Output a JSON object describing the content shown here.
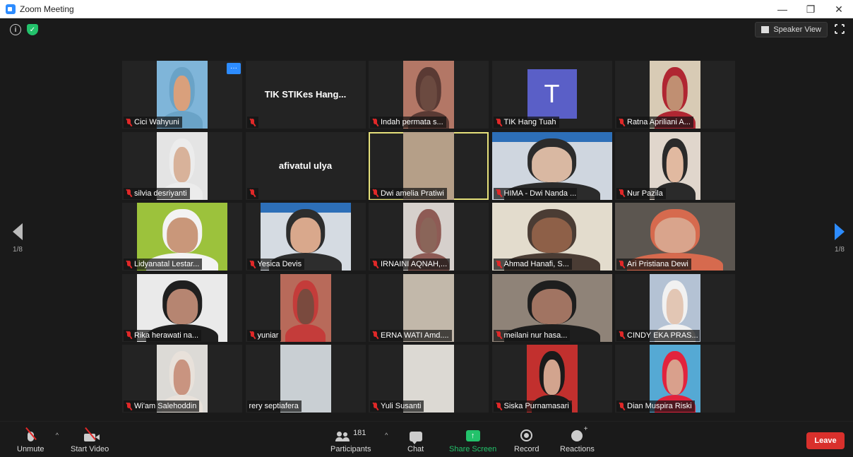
{
  "window": {
    "title": "Zoom Meeting"
  },
  "header": {
    "speaker_view_label": "Speaker View"
  },
  "navigation": {
    "page_indicator": "1/8"
  },
  "participants": [
    {
      "name": "Cici Wahyuni",
      "kind": "video",
      "w": "w70",
      "bg": "#7fb5d9",
      "skin": "#d9a07c",
      "cloth": "#6aa3c7",
      "more": "···"
    },
    {
      "name": "",
      "kind": "text",
      "text": "TIK STIKes Hang..."
    },
    {
      "name": "Indah permata s...",
      "kind": "video",
      "w": "w70",
      "bg": "#b37766",
      "skin": "#6b4a40",
      "cloth": "#5a3a34"
    },
    {
      "name": "TIK Hang Tuah",
      "kind": "avatar",
      "avatar": "T"
    },
    {
      "name": "Ratna Apriliani A...",
      "kind": "video",
      "w": "w70",
      "bg": "#d8cbb5",
      "skin": "#c08f72",
      "cloth": "#b02632"
    },
    {
      "name": "silvia desriyanti",
      "kind": "video",
      "w": "w70",
      "bg": "#e4e4e4",
      "skin": "#d8b29a",
      "cloth": "#ececec"
    },
    {
      "name": "",
      "kind": "text",
      "text": "afivatul ulya"
    },
    {
      "name": "Dwi amelia Pratiwi",
      "kind": "plain",
      "w": "w70",
      "bg": "#b59f88",
      "active": true
    },
    {
      "name": "HIMA - Dwi Nanda ...",
      "kind": "banner",
      "w": "full",
      "bg": "#cfd6df",
      "skin": "#d9b8a2",
      "cloth": "#2b2b2b"
    },
    {
      "name": "Nur Pazila",
      "kind": "video",
      "w": "w70",
      "bg": "#e0d6cc",
      "skin": "#e1b9a0",
      "cloth": "#2a2a2a"
    },
    {
      "name": "Lidyanatal Lestar...",
      "kind": "video",
      "w": "w128",
      "bg": "#9cc23c",
      "skin": "#c9977a",
      "cloth": "#f3f3f3"
    },
    {
      "name": "Yesica Devis",
      "kind": "banner",
      "w": "w128",
      "bg": "#d5dbe2",
      "skin": "#d9a88c",
      "cloth": "#2d2d2d"
    },
    {
      "name": "IRNAINI AQNAH,...",
      "kind": "video",
      "w": "w70",
      "bg": "#d6d0cc",
      "skin": "#8a6559",
      "cloth": "#8e5b55"
    },
    {
      "name": "Ahmad Hanafi, S...",
      "kind": "video",
      "w": "full",
      "bg": "#e3dccd",
      "skin": "#8e6048",
      "cloth": "#4a3c34"
    },
    {
      "name": "Ari Pristiana Dewi",
      "kind": "video",
      "w": "full",
      "bg": "#5c5650",
      "skin": "#d9a48c",
      "cloth": "#d66a4e"
    },
    {
      "name": "Rika herawati na...",
      "kind": "video",
      "w": "w128",
      "bg": "#eaeaea",
      "skin": "#b68571",
      "cloth": "#1f1f1f"
    },
    {
      "name": "yuniar",
      "kind": "video",
      "w": "w70",
      "bg": "#b86a5a",
      "skin": "#7a4a3e",
      "cloth": "#c43c3a"
    },
    {
      "name": "ERNA WATI Amd....",
      "kind": "plain",
      "w": "w70",
      "bg": "#c2b8aa"
    },
    {
      "name": "meilani nur hasa...",
      "kind": "video",
      "w": "full",
      "bg": "#8f8378",
      "skin": "#a17462",
      "cloth": "#1e1e1e"
    },
    {
      "name": "CINDY EKA PRAS...",
      "kind": "video",
      "w": "w70",
      "bg": "#b4c2d4",
      "skin": "#e2c6b4",
      "cloth": "#f1f1f1"
    },
    {
      "name": "Wi'am Salehoddin",
      "kind": "video",
      "w": "w70",
      "bg": "#dcdad6",
      "skin": "#c99480",
      "cloth": "#e8e1da"
    },
    {
      "name": "rery septiafera",
      "kind": "plain",
      "w": "w70",
      "bg": "#c9cfd3",
      "nomute": true
    },
    {
      "name": "Yuli Susanti",
      "kind": "plain",
      "w": "w70",
      "bg": "#dcd9d3"
    },
    {
      "name": "Siska Purnamasari",
      "kind": "video",
      "w": "w70",
      "bg": "#c2302e",
      "skin": "#d2a48e",
      "cloth": "#1a1a1a"
    },
    {
      "name": "Dian Muspira Riski",
      "kind": "video",
      "w": "w70",
      "bg": "#55a9d4",
      "skin": "#d9a08c",
      "cloth": "#e2233d"
    }
  ],
  "toolbar": {
    "unmute_label": "Unmute",
    "start_video_label": "Start Video",
    "participants_label": "Participants",
    "participants_count": "181",
    "chat_label": "Chat",
    "share_screen_label": "Share Screen",
    "share_arrow": "↑",
    "record_label": "Record",
    "reactions_label": "Reactions",
    "leave_label": "Leave",
    "caret": "^"
  },
  "colors": {
    "accent": "#2d8cff",
    "share_green": "#23c26b",
    "leave_red": "#d9302c",
    "active_speaker": "#e5e07a"
  }
}
